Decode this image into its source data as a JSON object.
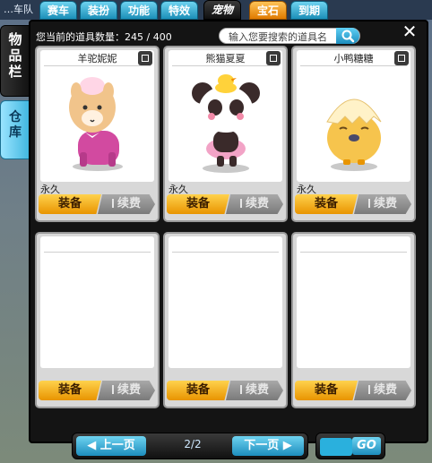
{
  "top_strip": {
    "text": "…车队"
  },
  "tabs": [
    {
      "label": "赛车"
    },
    {
      "label": "装扮"
    },
    {
      "label": "功能"
    },
    {
      "label": "特效"
    },
    {
      "label": "宠物",
      "active": true
    },
    {
      "label": "宝石",
      "accent": "#e07a00"
    },
    {
      "label": "到期"
    }
  ],
  "side_tabs": {
    "items": "物品栏",
    "store": "仓库"
  },
  "header": {
    "count_label": "您当前的道具数量：245 / 400"
  },
  "search": {
    "placeholder": "输入您要搜索的道具名"
  },
  "cards": [
    {
      "name": "羊驼妮妮",
      "duration": "永久",
      "equip": "装备",
      "renew": "续费",
      "pet": "alpaca"
    },
    {
      "name": "熊猫夏夏",
      "duration": "永久",
      "equip": "装备",
      "renew": "续费",
      "pet": "panda"
    },
    {
      "name": "小鸭糖糖",
      "duration": "永久",
      "equip": "装备",
      "renew": "续费",
      "pet": "duckling"
    },
    {
      "name": "",
      "duration": "",
      "equip": "装备",
      "renew": "续费"
    },
    {
      "name": "",
      "duration": "",
      "equip": "装备",
      "renew": "续费"
    },
    {
      "name": "",
      "duration": "",
      "equip": "装备",
      "renew": "续费"
    }
  ],
  "pager": {
    "prev": "上一页",
    "next": "下一页",
    "page": "2/2",
    "go": "GO"
  },
  "colors": {
    "accent_blue": "#1d8dbd",
    "equip_orange": "#e89400",
    "renew_gray": "#7a7a7a"
  }
}
